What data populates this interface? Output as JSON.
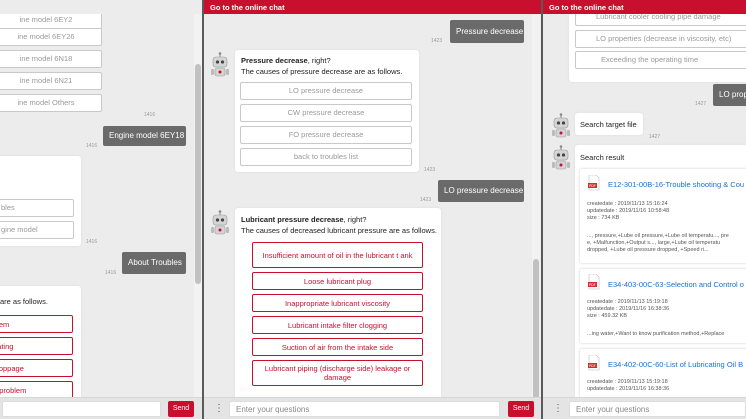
{
  "header_title": "Go to the online chat",
  "footer": {
    "placeholder": "Enter your questions",
    "send_label": "Send",
    "menu_glyph": "⋮"
  },
  "panel1": {
    "model_options": [
      "ine model 6EY26",
      "ine model 6EY26",
      "ine model 6N18",
      "ine model 6N21",
      "ine model Others"
    ],
    "model_options_display": [
      "ine model 6EY2",
      "ine model 6EY26",
      "ine model 6N18",
      "ine model 6N21",
      "ine model Others"
    ],
    "time1": "1416",
    "user_msg1": "Engine model 6EY18",
    "time2": "1416",
    "mid_options": [
      "bles",
      "gine model"
    ],
    "time3": "1416",
    "user_msg2": "About Troubles",
    "time4": "1416",
    "bot_text": "are as follows.",
    "red_options": [
      "blem",
      "eating",
      "stoppage",
      "e problem"
    ]
  },
  "panel2": {
    "user_msg_top": "Pressure decrease",
    "time_top": "1423",
    "bot1_title": "Pressure decrease",
    "bot1_title_suffix": ", right?",
    "bot1_line2": "The causes of pressure decrease are as follows.",
    "bot1_options": [
      "LO pressure decrease",
      "CW pressure decrease",
      "FO pressure decrease",
      "back to troubles list"
    ],
    "time_bot1": "1423",
    "user_msg2": "LO pressure decrease",
    "time_user2": "1423",
    "bot2_title": "Lubricant pressure decrease",
    "bot2_title_suffix": ", right?",
    "bot2_line2": "The causes of decreased lubricant pressure are as follows.",
    "bot2_options": [
      "Insufficient amount of oil in the lubricant t ank",
      "Loose lubricant plug",
      "Inappropriate lubricant viscosity",
      "Lubricant intake filter clogging",
      "Suction of air from the intake side",
      "Lubricant piping (discharge side) leakage or damage"
    ]
  },
  "panel3": {
    "top_options": [
      "Lubricant cooler cooling pipe damage",
      "LO properties (decrease in viscosity, etc)",
      "Exceeding the operating time"
    ],
    "user_msg": "LO propo",
    "time1": "1427",
    "bot_search_target": "Search target file",
    "time2": "1427",
    "bot_search_result": "Search result",
    "results": [
      {
        "title": "E12-301-00B-16-Trouble shooting & Cou",
        "createdate": "createdate : 2019/11/13 15:16:24",
        "updatedate": "updatedate : 2019/11/16 10:58:48",
        "size": "size : 734 KB",
        "snippet1": "..., pressure,+Lube oil pressure,+Lube oil temperatu..., pre",
        "snippet2": "e, +Malfunction,+Output s..., large,+Lube oil temperatu",
        "snippet3": "dropped, +Lube oil pressure dropped, +Speed ri..."
      },
      {
        "title": "E34-403-00C-63-Selection and Control o",
        "createdate": "createdate : 2019/11/13 15:19:18",
        "updatedate": "updatedate : 2019/11/16 16:38:36",
        "size": "size : 459.32 KB",
        "snippet1": "...ing water,+Want to know purification method,+Replace"
      },
      {
        "title": "E34-402-00C-60-List of Lubricating Oil B",
        "createdate": "createdate : 2019/11/13 15:19:18",
        "updatedate": "updatedate : 2019/11/16 16:38:36"
      }
    ]
  }
}
